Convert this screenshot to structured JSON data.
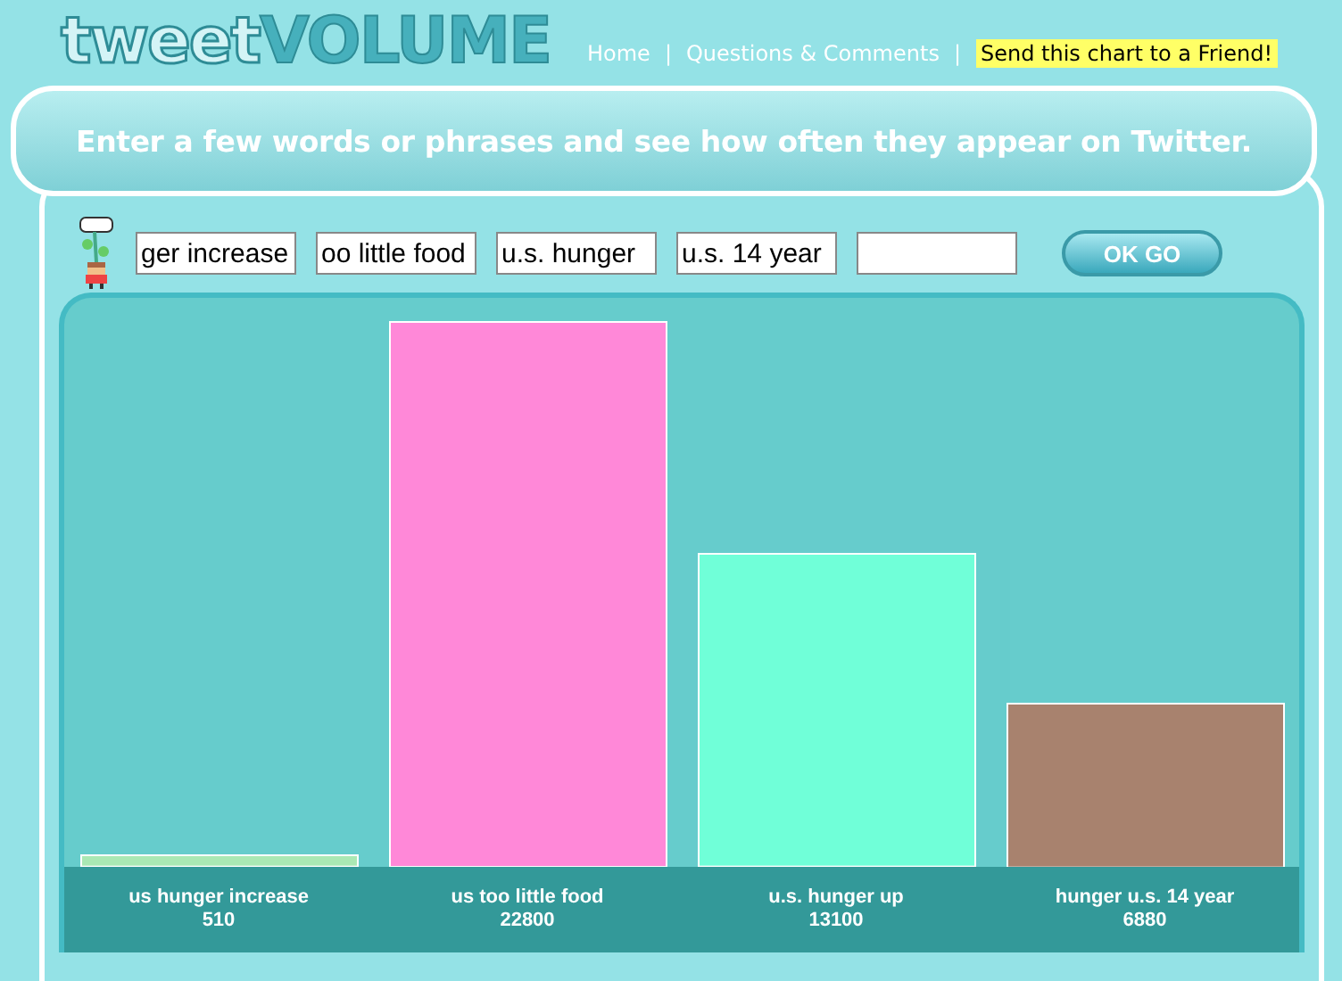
{
  "logo": {
    "part_1": "tweet",
    "part_2": "VOLUME"
  },
  "nav": [
    {
      "label": "Home",
      "kind": "link"
    },
    {
      "label": "|",
      "kind": "separator"
    },
    {
      "label": "Questions & Comments",
      "kind": "link"
    },
    {
      "label": "|",
      "kind": "separator"
    },
    {
      "label": "Send this chart to a Friend!",
      "kind": "highlight"
    }
  ],
  "headline": "Enter a few words or phrases and see how often they appear on Twitter.",
  "inputs": [
    {
      "value": "ger increase"
    },
    {
      "value": "oo little food"
    },
    {
      "value": "u.s. hunger"
    },
    {
      "value": "u.s. 14 year"
    }
  ],
  "blank_input_shown": true,
  "go_button": "OK GO",
  "chart_data": {
    "type": "bar",
    "categories": [
      "us hunger increase",
      "us too little food",
      "u.s. hunger up",
      "hunger u.s. 14 year"
    ],
    "values": [
      510,
      22800,
      13100,
      6880
    ],
    "colors": [
      "#aae8b4",
      "#ff88d8",
      "#70ffd8",
      "#a8826e"
    ],
    "data_labels": true
  }
}
